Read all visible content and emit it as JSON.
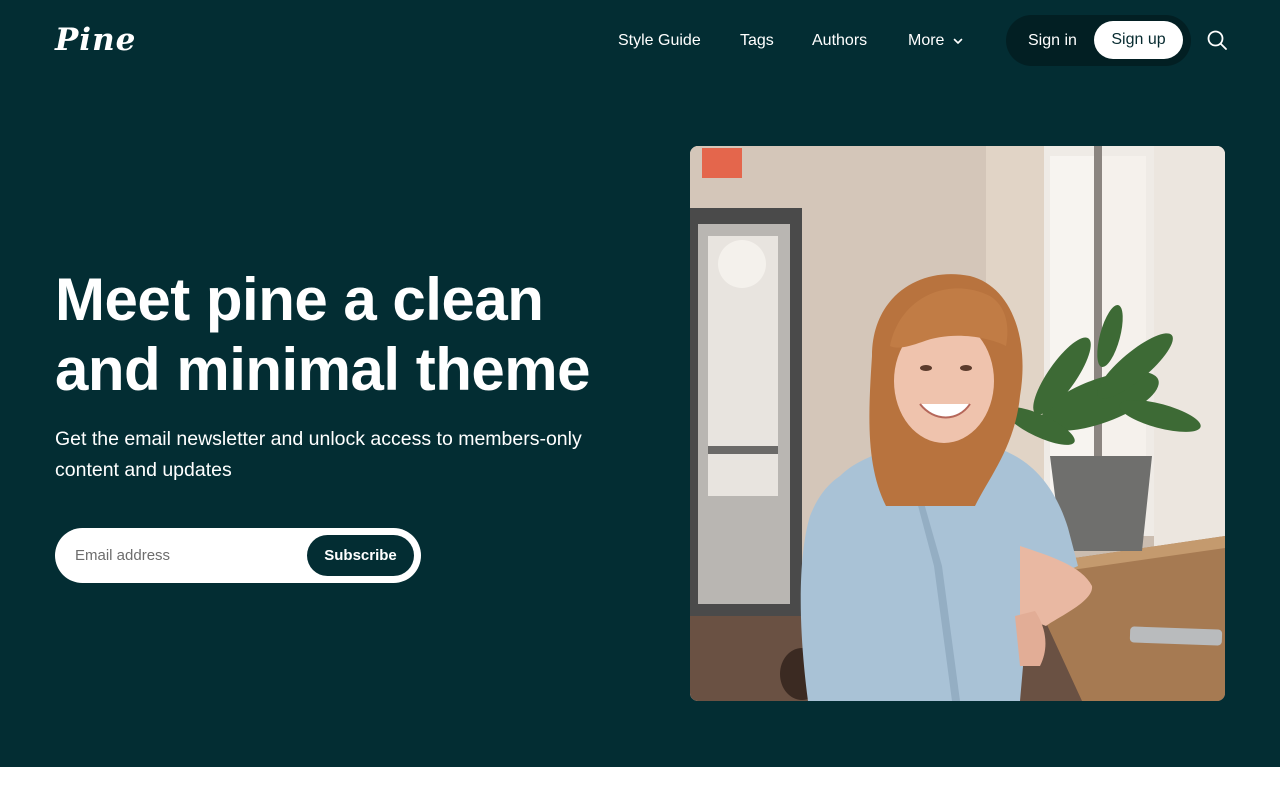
{
  "site": {
    "logo": "Pine"
  },
  "nav": {
    "items": [
      {
        "label": "Style Guide"
      },
      {
        "label": "Tags"
      },
      {
        "label": "Authors"
      },
      {
        "label": "More"
      }
    ],
    "signin_label": "Sign in",
    "signup_label": "Sign up",
    "search_icon": "search-icon"
  },
  "hero": {
    "headline": "Meet pine a clean and minimal theme",
    "subtext": "Get the email newsletter and unlock access to members-only content and updates",
    "email_placeholder": "Email address",
    "subscribe_label": "Subscribe",
    "photo": "smiling woman seated at a wooden window counter beside a potted plant"
  },
  "colors": {
    "hero_bg": "#032d33",
    "pill_bg": "#021f23",
    "text": "#ffffff",
    "page_bg": "#ffffff"
  }
}
